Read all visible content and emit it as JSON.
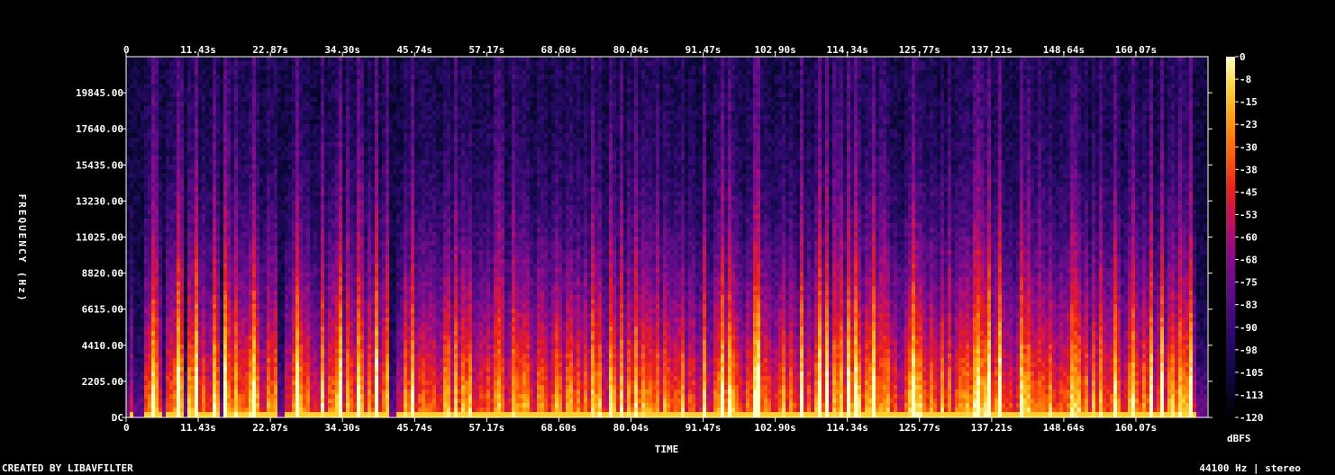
{
  "chart_data": {
    "type": "heatmap",
    "xlabel": "TIME",
    "ylabel": "FREQUENCY (Hz)",
    "x_ticks": [
      "0",
      "11.43s",
      "22.87s",
      "34.30s",
      "45.74s",
      "57.17s",
      "68.60s",
      "80.04s",
      "91.47s",
      "102.90s",
      "114.34s",
      "125.77s",
      "137.21s",
      "148.64s",
      "160.07s"
    ],
    "x_tick_values": [
      0,
      11.43,
      22.87,
      34.3,
      45.74,
      57.17,
      68.6,
      80.04,
      91.47,
      102.9,
      114.34,
      125.77,
      137.21,
      148.64,
      160.07
    ],
    "x_range": [
      0,
      171.5
    ],
    "y_ticks": [
      "DC",
      "2205.00",
      "4410.00",
      "6615.00",
      "8820.00",
      "11025.00",
      "13230.00",
      "15435.00",
      "17640.00",
      "19845.00"
    ],
    "y_tick_values": [
      0,
      2205,
      4410,
      6615,
      8820,
      11025,
      13230,
      15435,
      17640,
      19845
    ],
    "y_range": [
      0,
      22050
    ],
    "colorbar": {
      "label": "dBFS",
      "ticks": [
        "0",
        "-8",
        "-15",
        "-23",
        "-30",
        "-38",
        "-45",
        "-53",
        "-60",
        "-68",
        "-75",
        "-83",
        "-90",
        "-98",
        "-105",
        "-113",
        "-120"
      ],
      "range": [
        -120,
        0
      ]
    },
    "colors": {
      "background": "#000000",
      "frame": "#ffffff",
      "colormap": [
        "#000000",
        "#0a0838",
        "#2a0a6a",
        "#5a0c86",
        "#8a0c8a",
        "#c41060",
        "#e8201c",
        "#ff5a0a",
        "#ff9a0a",
        "#ffd030",
        "#ffffc0"
      ]
    }
  },
  "footer": {
    "left": "CREATED BY LIBAVFILTER",
    "right": "44100 Hz | stereo"
  }
}
